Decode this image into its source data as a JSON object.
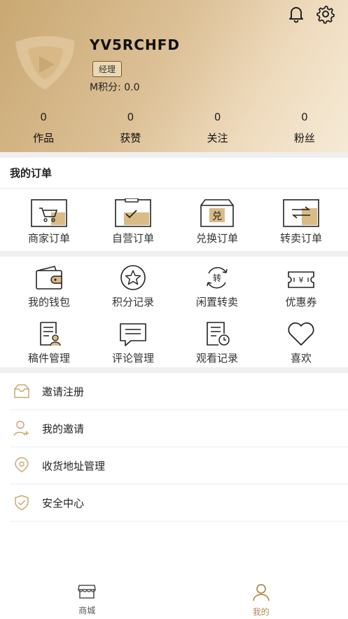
{
  "profile": {
    "username": "YV5RCHFD",
    "role": "经理",
    "points": "M积分: 0.0"
  },
  "stats": [
    {
      "value": "0",
      "label": "作品"
    },
    {
      "value": "0",
      "label": "获赞"
    },
    {
      "value": "0",
      "label": "关注"
    },
    {
      "value": "0",
      "label": "粉丝"
    }
  ],
  "orders": {
    "title": "我的订单",
    "items": [
      {
        "label": "商家订单",
        "icon": "shopping-cart-icon"
      },
      {
        "label": "自营订单",
        "icon": "checkmark-box-icon"
      },
      {
        "label": "兑换订单",
        "icon": "exchange-box-icon",
        "icon_text": "兑"
      },
      {
        "label": "转卖订单",
        "icon": "transfer-arrows-icon"
      }
    ]
  },
  "services": {
    "row1": [
      {
        "label": "我的钱包",
        "icon": "wallet-icon"
      },
      {
        "label": "积分记录",
        "icon": "star-icon"
      },
      {
        "label": "闲置转卖",
        "icon": "resale-cycle-icon",
        "icon_text": "转"
      },
      {
        "label": "优惠券",
        "icon": "coupon-icon",
        "icon_text": "¥"
      }
    ],
    "row2": [
      {
        "label": "稿件管理",
        "icon": "manuscript-icon"
      },
      {
        "label": "评论管理",
        "icon": "comment-icon"
      },
      {
        "label": "观看记录",
        "icon": "watch-history-icon"
      },
      {
        "label": "喜欢",
        "icon": "heart-icon"
      }
    ]
  },
  "menu": [
    {
      "label": "邀请注册",
      "icon": "invite-register-icon"
    },
    {
      "label": "我的邀请",
      "icon": "user-add-icon"
    },
    {
      "label": "收货地址管理",
      "icon": "location-icon"
    },
    {
      "label": "安全中心",
      "icon": "shield-icon"
    }
  ],
  "tabbar": [
    {
      "label": "商城",
      "icon": "store-icon",
      "active": false
    },
    {
      "label": "我的",
      "icon": "user-icon",
      "active": true
    }
  ],
  "colors": {
    "accent": "#b8955e",
    "tab_active": "#b08a4e",
    "tab_inactive": "#555555",
    "header_start": "#c9a872",
    "header_end": "#f6ead6"
  }
}
